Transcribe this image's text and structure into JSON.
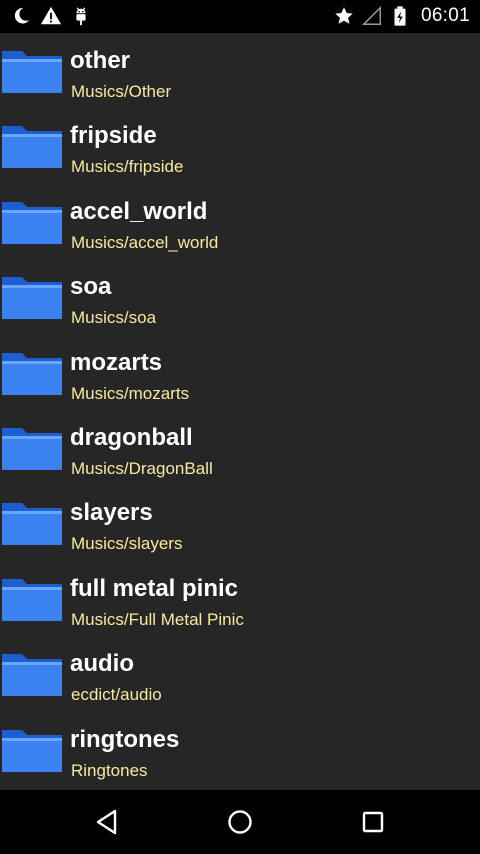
{
  "status_bar": {
    "time": "06:01",
    "left_icons": [
      "moon-icon",
      "warning-icon",
      "android-debug-icon"
    ],
    "right_icons": [
      "star-icon",
      "signal-icon",
      "battery-icon"
    ]
  },
  "folders": [
    {
      "name": "other",
      "path": "Musics/Other"
    },
    {
      "name": "fripside",
      "path": "Musics/fripside"
    },
    {
      "name": "accel_world",
      "path": "Musics/accel_world"
    },
    {
      "name": "soa",
      "path": "Musics/soa"
    },
    {
      "name": "mozarts",
      "path": "Musics/mozarts"
    },
    {
      "name": "dragonball",
      "path": "Musics/DragonBall"
    },
    {
      "name": "slayers",
      "path": "Musics/slayers"
    },
    {
      "name": "full metal pinic",
      "path": "Musics/Full Metal Pinic"
    },
    {
      "name": "audio",
      "path": "ecdict/audio"
    },
    {
      "name": "ringtones",
      "path": "Ringtones"
    }
  ],
  "nav_bar": {
    "icons": [
      "back-icon",
      "home-icon",
      "recents-icon"
    ]
  },
  "colors": {
    "list_background": "#262626",
    "folder_name": "#ffffff",
    "folder_path": "#f7e9a0",
    "folder_icon": "#3b82f0"
  }
}
